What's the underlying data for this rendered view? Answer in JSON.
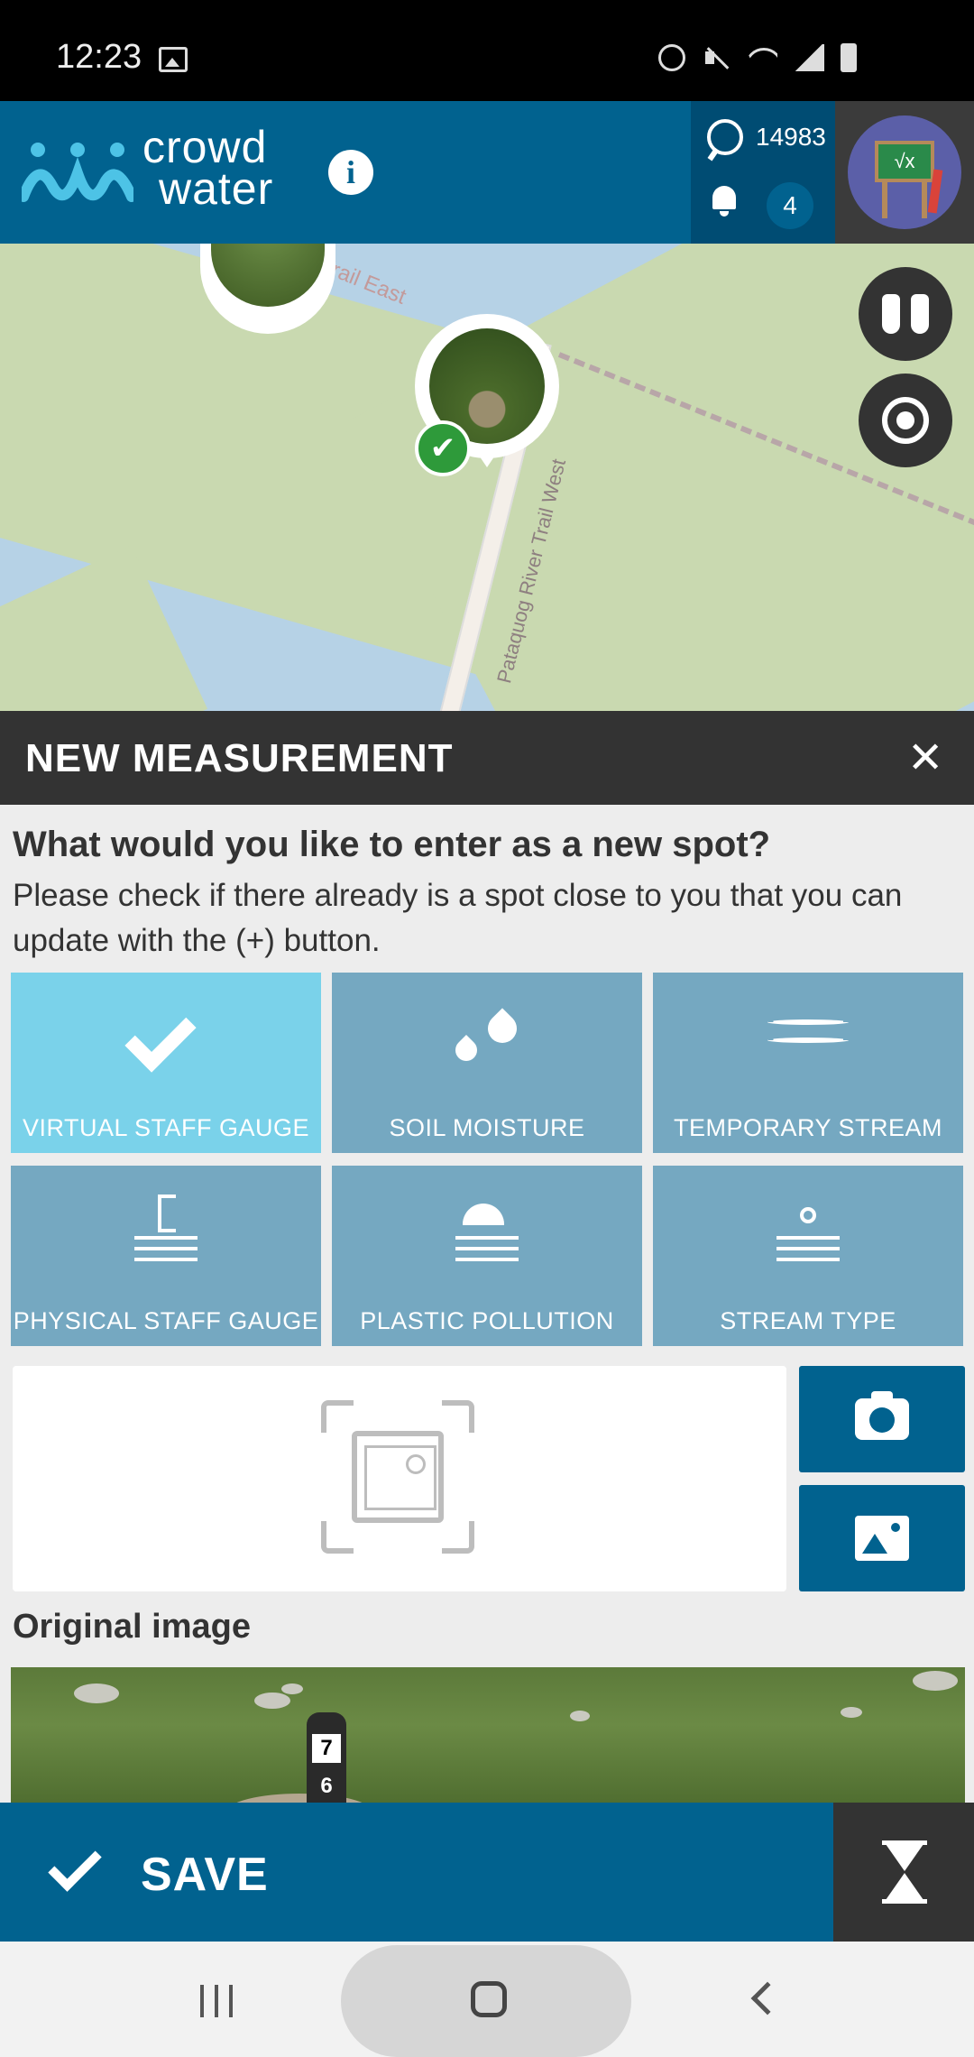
{
  "status_bar": {
    "time": "12:23",
    "icons": [
      "gallery-icon",
      "alarm-icon",
      "mute-icon",
      "wifi-icon",
      "signal-icon",
      "battery-icon"
    ]
  },
  "header": {
    "logo_line1": "crowd",
    "logo_line2": "water",
    "info_label": "i",
    "points": "14983",
    "notifications": "4",
    "avatar_symbol": "√x"
  },
  "map": {
    "trail_label": "Trail East",
    "road_label": "Pataquog River Trail West",
    "buttons": [
      "binoculars-icon",
      "locate-icon"
    ]
  },
  "panel": {
    "title": "NEW MEASUREMENT",
    "close_label": "✕",
    "question": "What would you like to enter as a new spot?",
    "hint": "Please check if there already is a spot close to you that you can update with the (+) button.",
    "spot_types": [
      {
        "label": "VIRTUAL STAFF GAUGE",
        "selected": true
      },
      {
        "label": "SOIL MOISTURE",
        "selected": false
      },
      {
        "label": "TEMPORARY STREAM",
        "selected": false
      },
      {
        "label": "PHYSICAL STAFF GAUGE",
        "selected": false
      },
      {
        "label": "PLASTIC POLLUTION",
        "selected": false
      },
      {
        "label": "STREAM TYPE",
        "selected": false
      }
    ],
    "original_image_label": "Original image",
    "staff_numbers": [
      "7",
      "6"
    ]
  },
  "footer": {
    "save_label": "SAVE"
  },
  "colors": {
    "primary": "#01628f",
    "tile": "#75a8c1",
    "tile_selected": "#7ad2ea",
    "dark": "#333333",
    "success": "#2e9a3a"
  }
}
